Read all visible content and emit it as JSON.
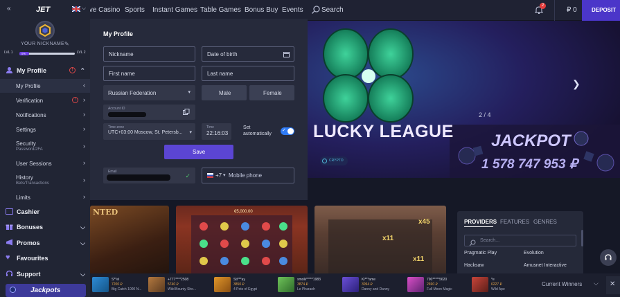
{
  "header": {
    "nav": [
      "Live Casino",
      "Sports",
      "Instant Games",
      "Table Games",
      "Bonus Buy",
      "Events"
    ],
    "search_label": "Search",
    "notification_count": "2",
    "balance": "₽ 0",
    "deposit_label": "DEPOSIT"
  },
  "sidebar": {
    "logo": "JET",
    "nickname": "YOUR NICKNAME",
    "level_current": "LVL 1",
    "level_progress": "0%",
    "level_next": "LVL 2",
    "level_progress_value": 0.0,
    "items": [
      {
        "label": "My Profile"
      },
      {
        "label": "My Profile"
      },
      {
        "label": "Verification"
      },
      {
        "label": "Notifications"
      },
      {
        "label": "Settings"
      },
      {
        "label": "Security",
        "sub": "Password/2FA"
      },
      {
        "label": "User Sessions"
      },
      {
        "label": "History",
        "sub": "Bets/Transactions"
      },
      {
        "label": "Limits"
      },
      {
        "label": "Cashier"
      },
      {
        "label": "Bonuses"
      },
      {
        "label": "Promos"
      },
      {
        "label": "Favourites"
      },
      {
        "label": "Support"
      }
    ],
    "jackpots_label": "Jackpots"
  },
  "profile": {
    "title": "My Profile",
    "nickname_placeholder": "Nickname",
    "dob_placeholder": "Date of birth",
    "firstname_placeholder": "First name",
    "lastname_placeholder": "Last name",
    "country": "Russian Federation",
    "male_label": "Male",
    "female_label": "Female",
    "account_id_label": "Account ID",
    "timezone_label": "Time zone",
    "timezone_value": "UTC+03:00 Moscow, St. Petersb...",
    "time_label": "Time",
    "time_value": "22:16:03",
    "set_auto_label": "Set automatically",
    "save_label": "Save",
    "email_label": "Email",
    "phone_code": "+7",
    "phone_placeholder": "Mobile phone"
  },
  "banner": {
    "title": "LUCKY LEAGUE",
    "pagination": "2 / 4",
    "jackpot_label": "JACKPOT",
    "jackpot_amount": "1 578 747 953 ₽",
    "badge": "CRYPTO"
  },
  "providers_panel": {
    "tabs": [
      "PROVIDERS",
      "FEATURES",
      "GENRES"
    ],
    "search_placeholder": "Search...",
    "items": [
      "Pragmatic Play",
      "Evolution",
      "Hacksaw",
      "Amusnet Interactive"
    ]
  },
  "cards": {
    "card2_value": "€5,000.00"
  },
  "winners": [
    {
      "name": "S**el",
      "amount": "7200 ₽",
      "game": "Big Catch 1000 N..."
    },
    {
      "name": "+777****2508",
      "amount": "5740 ₽",
      "game": "Wild Bounty Sho..."
    },
    {
      "name": "Sti***ay",
      "amount": "3850 ₽",
      "game": "4 Pots of Egypt"
    },
    {
      "name": "smolk*****1983",
      "amount": "3874 ₽",
      "game": "Le Pharaoh"
    },
    {
      "name": "Ki***ame",
      "amount": "3094 ₽",
      "game": "Danny and Danny"
    },
    {
      "name": "790*****5620",
      "amount": "2690 ₽",
      "game": "Full Moon Magic"
    },
    {
      "name": "*e",
      "amount": "6227 ₽",
      "game": "Wild Ape"
    }
  ],
  "current_winners_label": "Current Winners",
  "colors": {
    "accent": "#5b45d3",
    "deposit": "#4b36c9",
    "toggle": "#2f7bf5",
    "jackpot": "#c9c2ff"
  }
}
